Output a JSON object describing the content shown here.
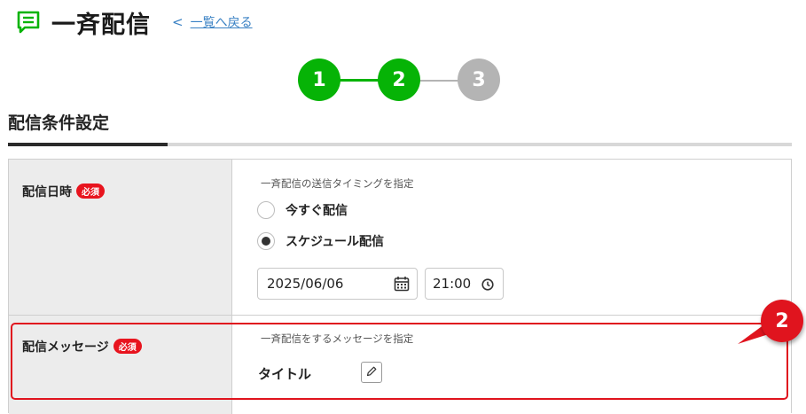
{
  "header": {
    "title": "一斉配信",
    "icon": "message-list-icon",
    "back_link": "一覧へ戻る",
    "back_chevron": "<"
  },
  "stepper": {
    "steps": [
      {
        "label": "1",
        "state": "done"
      },
      {
        "label": "2",
        "state": "current"
      },
      {
        "label": "3",
        "state": "upcoming"
      }
    ],
    "active_color": "#06b306",
    "inactive_color": "#b4b4b4"
  },
  "section": {
    "title": "配信条件設定"
  },
  "form": {
    "schedule": {
      "label": "配信日時",
      "required_badge": "必須",
      "hint": "一斉配信の送信タイミングを指定",
      "options": [
        {
          "label": "今すぐ配信",
          "checked": false
        },
        {
          "label": "スケジュール配信",
          "checked": true
        }
      ],
      "date_value": "2025/06/06",
      "time_value": "21:00"
    },
    "message": {
      "label": "配信メッセージ",
      "required_badge": "必須",
      "hint": "一斉配信をするメッセージを指定",
      "title_label": "タイトル"
    }
  },
  "annotation": {
    "callout_number": "2",
    "color": "#e0141e"
  }
}
